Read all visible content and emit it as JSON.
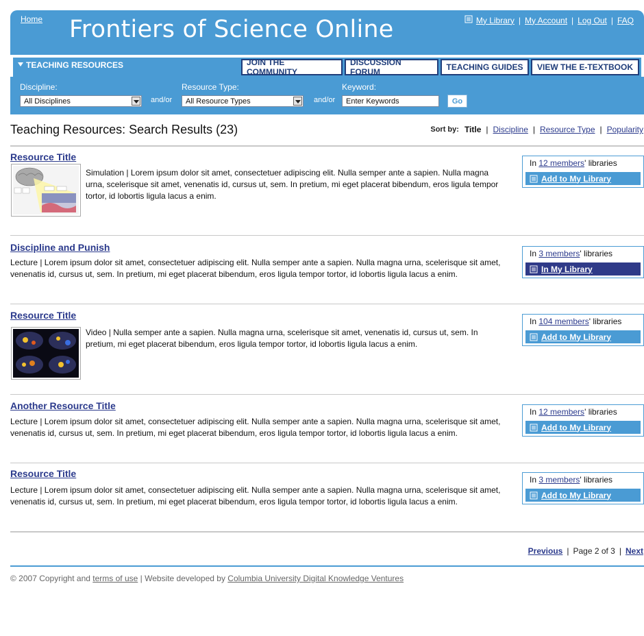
{
  "header": {
    "home_link": "Home",
    "site_title": "Frontiers of Science Online",
    "util_nav": {
      "my_library": "My Library",
      "my_account": "My Account",
      "log_out": "Log Out",
      "faq": "FAQ",
      "separator": "|"
    }
  },
  "tabs": {
    "active_tab": "TEACHING RESOURCES",
    "nav_buttons": [
      "JOIN THE COMMUNITY",
      "DISCUSSION FORUM",
      "TEACHING GUIDES",
      "VIEW THE E-TEXTBOOK"
    ]
  },
  "search": {
    "discipline_label": "Discipline:",
    "discipline_value": "All Disciplines",
    "andor_1": "and/or",
    "resource_type_label": "Resource Type:",
    "resource_type_value": "All Resource Types",
    "andor_2": "and/or",
    "keyword_label": "Keyword:",
    "keyword_value": "Enter Keywords",
    "go_button": "Go"
  },
  "results_header": {
    "title": "Teaching Resources: Search Results (23)",
    "sort_label": "Sort by:",
    "sort_options": [
      "Title",
      "Discipline",
      "Resource Type",
      "Popularity"
    ],
    "active_sort": "Title"
  },
  "results": [
    {
      "title": "Resource Title",
      "description": "Simulation | Lorem ipsum dolor sit amet, consectetuer adipiscing elit. Nulla semper ante a sapien. Nulla magna urna, scelerisque sit amet, venenatis id, cursus ut, sem. In pretium, mi eget placerat bibendum, eros ligula tempor tortor, id lobortis ligula lacus a enim.",
      "has_thumb": true,
      "lib_prefix": "In",
      "members_link": "12 members",
      "lib_suffix": "' libraries",
      "action": "Add to My Library",
      "in_library": false
    },
    {
      "title": "Discipline and Punish",
      "description": "Lecture | Lorem ipsum dolor sit amet, consectetuer adipiscing elit. Nulla semper ante a sapien. Nulla magna urna, scelerisque sit amet, venenatis id, cursus ut, sem. In pretium, mi eget placerat bibendum, eros ligula tempor tortor, id lobortis ligula lacus a enim.",
      "has_thumb": false,
      "lib_prefix": "In",
      "members_link": "3 members",
      "lib_suffix": "' libraries",
      "action": "In My Library",
      "in_library": true
    },
    {
      "title": "Resource Title",
      "description": "Video | Nulla semper ante a sapien. Nulla magna urna, scelerisque sit amet, venenatis id, cursus ut, sem. In pretium, mi eget placerat bibendum, eros ligula tempor tortor, id lobortis ligula lacus a enim.",
      "has_thumb": true,
      "lib_prefix": "In",
      "members_link": "104 members",
      "lib_suffix": "' libraries",
      "action": "Add to My Library",
      "in_library": false
    },
    {
      "title": "Another Resource Title",
      "description": "Lecture | Lorem ipsum dolor sit amet, consectetuer adipiscing elit. Nulla semper ante a sapien. Nulla magna urna, scelerisque sit amet, venenatis id, cursus ut, sem. In pretium, mi eget placerat bibendum, eros ligula tempor tortor, id lobortis ligula lacus a enim.",
      "has_thumb": false,
      "lib_prefix": "In",
      "members_link": "12 members",
      "lib_suffix": "' libraries",
      "action": "Add to My Library",
      "in_library": false
    },
    {
      "title": "Resource Title",
      "description": "Lecture | Lorem ipsum dolor sit amet, consectetuer adipiscing elit. Nulla semper ante a sapien. Nulla magna urna, scelerisque sit amet, venenatis id, cursus ut, sem. In pretium, mi eget placerat bibendum, eros ligula tempor tortor, id lobortis ligula lacus a enim.",
      "has_thumb": false,
      "lib_prefix": "In",
      "members_link": "3 members",
      "lib_suffix": "' libraries",
      "action": "Add to My Library",
      "in_library": false
    }
  ],
  "pager": {
    "previous": "Previous",
    "status": "Page 2 of 3",
    "next": "Next",
    "separator": "|"
  },
  "footer": {
    "copyright_prefix": "© 2007 Copyright and",
    "terms_link": "terms of use",
    "developed_by": "| Website developed by",
    "developer_link": "Columbia University Digital Knowledge Ventures"
  },
  "colors": {
    "header_blue": "#4a9bd4",
    "link_navy": "#2b3a8c",
    "in_library_navy": "#2f3a88"
  }
}
